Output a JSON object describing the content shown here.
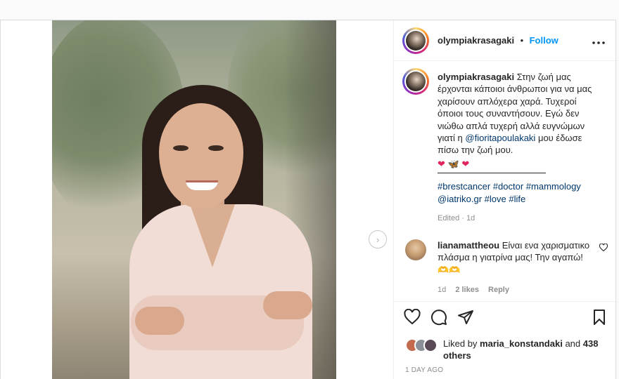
{
  "post": {
    "author": "olympiakrasagaki",
    "separator_dot": "•",
    "follow_label": "Follow",
    "more_label": "•••",
    "caption": {
      "author": "olympiakrasagaki",
      "text_before_mention": "Στην ζωή μας έρχονται κάποιοι άνθρωποι για να μας χαρίσουν απλόχερα χαρά. Τυχεροί όποιοι τους συναντήσουν. Εγώ δεν νιώθω απλά τυχερή αλλά ευγνώμων γιατί η",
      "mention": "@fioritapoulakaki",
      "text_after_mention": "μου έδωσε πίσω την ζωή μου.",
      "emojis": [
        "❤",
        "🦋",
        "❤"
      ],
      "hashtags": [
        "#brestcancer",
        "#doctor",
        "#mammology",
        "@iatriko.gr",
        "#love",
        "#life"
      ]
    },
    "edited_label": "Edited · 1d",
    "next_icon": "chevron-right-icon",
    "next_glyph": "›"
  },
  "comment": {
    "author": "lianamattheou",
    "text": "Είναι ενα χαρισματικο πλάσμα η γιατρίνα μας! Την αγαπώ! 🫶🫶",
    "time": "1d",
    "likes": "2 likes",
    "reply_label": "Reply"
  },
  "actions": {
    "icons": [
      "heart-icon",
      "comment-icon",
      "share-icon",
      "bookmark-icon"
    ]
  },
  "likes": {
    "prefix": "Liked by",
    "user": "maria_konstandaki",
    "and": "and",
    "others": "438 others"
  },
  "timestamp": "1 DAY AGO",
  "colors": {
    "accent": "#0095f6",
    "link": "#00376b",
    "muted": "#8e8e8e",
    "text": "#262626",
    "border": "#dbdbdb"
  }
}
